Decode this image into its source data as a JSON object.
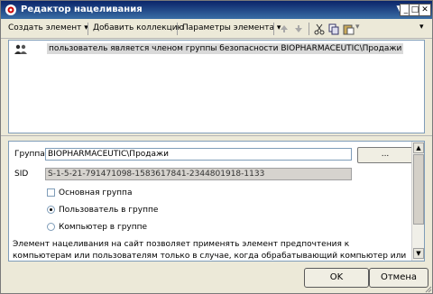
{
  "window": {
    "title": "Редактор нацеливания"
  },
  "toolbar": {
    "create_element": "Создать элемент",
    "add_collection": "Добавить коллекцию",
    "element_params": "Параметры элемента"
  },
  "rules": [
    {
      "text": "пользователь является членом группы безопасности BIOPHARMACEUTIC\\Продажи"
    }
  ],
  "properties": {
    "group_label": "Группа",
    "group_value": "BIOPHARMACEUTIC\\Продажи",
    "browse_label": "...",
    "sid_label": "SID",
    "sid_value": "S-1-5-21-791471098-1583617841-2344801918-1133",
    "primary_group_label": "Основная группа",
    "user_in_group_label": "Пользователь в группе",
    "computer_in_group_label": "Компьютер в группе",
    "selected_option": "Пользователь в группе",
    "description": "Элемент нацеливания на сайт позволяет применять элемент предпочтения к компьютерам или пользователям только в случае, когда обрабатывающий компьютер или пользователь является членом"
  },
  "buttons": {
    "ok": "OK",
    "cancel": "Отмена"
  },
  "colors": {
    "titlebar": "#0a246a",
    "panel_border": "#7f9db9"
  }
}
